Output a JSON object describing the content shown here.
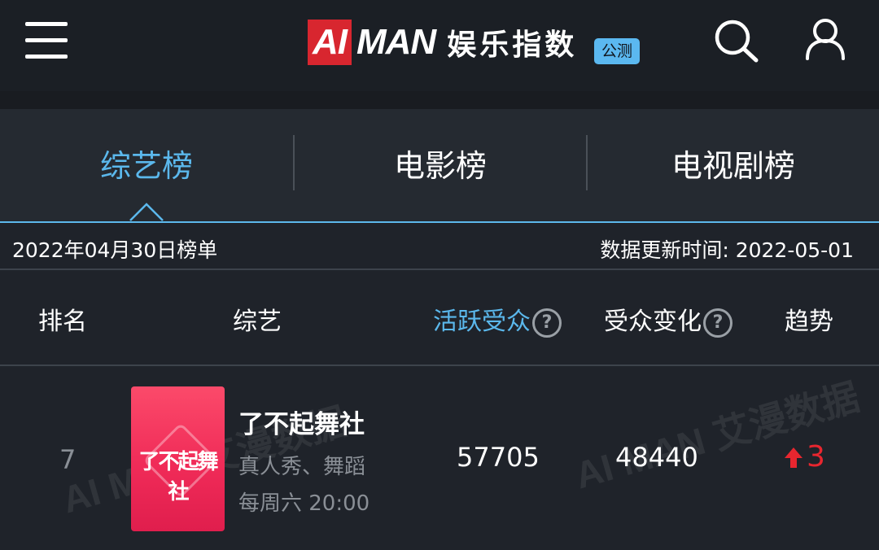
{
  "header": {
    "logo_ai": "AI",
    "logo_man": "MAN",
    "logo_cn": "娱乐指数",
    "badge": "公测",
    "icons": {
      "menu": "menu-icon",
      "search": "search-icon",
      "user": "user-icon"
    }
  },
  "tabs": [
    {
      "label": "综艺榜",
      "active": true
    },
    {
      "label": "电影榜",
      "active": false
    },
    {
      "label": "电视剧榜",
      "active": false
    }
  ],
  "date_row": {
    "list_date": "2022年04月30日榜单",
    "update_time": "数据更新时间: 2022-05-01"
  },
  "columns": {
    "rank": "排名",
    "show": "综艺",
    "active_audience": "活跃受众",
    "audience_change": "受众变化",
    "trend": "趋势",
    "help_glyph": "?"
  },
  "rows": [
    {
      "rank": "7",
      "poster_text": "了不起舞社",
      "name": "了不起舞社",
      "genre": "真人秀、舞蹈",
      "schedule": "每周六 20:00",
      "active_audience": "57705",
      "audience_change": "48440",
      "trend_direction": "up",
      "trend_value": "3"
    }
  ],
  "watermarks": [
    "AI MAN 艾漫数据",
    "AI MAN 艾漫数据"
  ],
  "colors": {
    "accent": "#5bb8ec",
    "trend_up": "#e8262f",
    "logo_red": "#d8262f",
    "poster_pink": "#f02b58"
  }
}
